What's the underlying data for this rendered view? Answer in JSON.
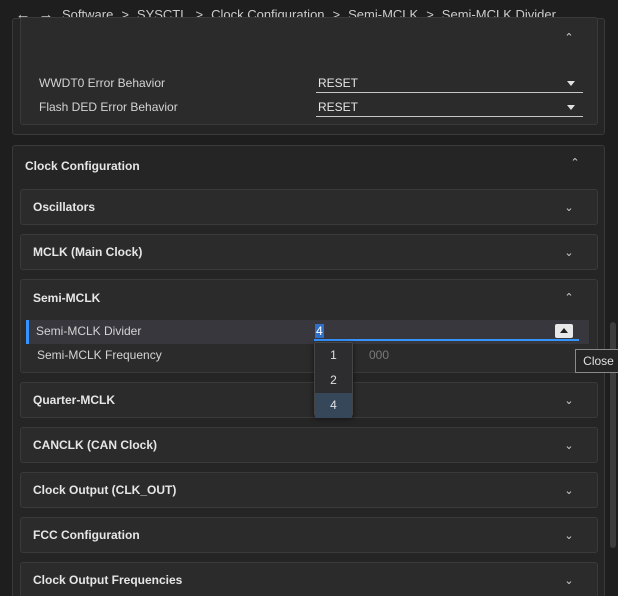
{
  "breadcrumb": {
    "items": [
      {
        "label": "Software",
        "link": false
      },
      {
        "label": "SYSCTL",
        "link": false
      },
      {
        "label": "Clock Configuration",
        "link": true
      },
      {
        "label": "Semi-MCLK",
        "link": true
      },
      {
        "label": "Semi-MCLK Divider",
        "link": true
      }
    ],
    "separator": ">"
  },
  "error_panel": {
    "rows": [
      {
        "label": "WWDT0 Error Behavior",
        "value": "RESET"
      },
      {
        "label": "Flash DED Error Behavior",
        "value": "RESET"
      }
    ]
  },
  "clock_panel": {
    "title": "Clock Configuration",
    "sections": {
      "oscillators": "Oscillators",
      "mclk": "MCLK (Main Clock)",
      "semi_mclk": "Semi-MCLK",
      "quarter_mclk": "Quarter-MCLK",
      "canclk": "CANCLK (CAN Clock)",
      "clk_out": "Clock Output (CLK_OUT)",
      "fcc": "FCC Configuration",
      "clk_out_freq": "Clock Output Frequencies"
    },
    "semi_mclk": {
      "divider_label": "Semi-MCLK Divider",
      "divider_value": "4",
      "frequency_label": "Semi-MCLK Frequency",
      "frequency_value": "000"
    }
  },
  "dropdown": {
    "options": [
      "1",
      "2",
      "4"
    ],
    "selected": "4"
  },
  "tooltip": {
    "text": "Close"
  },
  "icons": {
    "back": "arrow-left-icon",
    "forward": "arrow-right-icon",
    "expand": "chevron-down-icon",
    "collapse": "chevron-up-icon"
  },
  "colors": {
    "accent": "#3794ff",
    "background": "#1e1e1e",
    "panel": "#252526",
    "dropdown_selected": "#37475a"
  }
}
